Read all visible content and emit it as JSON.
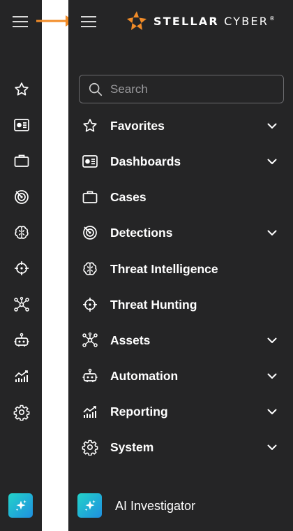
{
  "brand": {
    "name_bold": "STELLAR",
    "name_thin": " CYBER",
    "mark": "®",
    "accent": "#f28c28"
  },
  "search": {
    "placeholder": "Search",
    "value": ""
  },
  "nav": [
    {
      "key": "favorites",
      "label": "Favorites",
      "icon": "star-icon",
      "expandable": true
    },
    {
      "key": "dashboards",
      "label": "Dashboards",
      "icon": "dashboard-icon",
      "expandable": true
    },
    {
      "key": "cases",
      "label": "Cases",
      "icon": "briefcase-icon",
      "expandable": false
    },
    {
      "key": "detections",
      "label": "Detections",
      "icon": "radar-icon",
      "expandable": true
    },
    {
      "key": "threat-intelligence",
      "label": "Threat Intelligence",
      "icon": "brain-icon",
      "expandable": false
    },
    {
      "key": "threat-hunting",
      "label": "Threat Hunting",
      "icon": "crosshair-icon",
      "expandable": false
    },
    {
      "key": "assets",
      "label": "Assets",
      "icon": "network-icon",
      "expandable": true
    },
    {
      "key": "automation",
      "label": "Automation",
      "icon": "robot-icon",
      "expandable": true
    },
    {
      "key": "reporting",
      "label": "Reporting",
      "icon": "chart-icon",
      "expandable": true
    },
    {
      "key": "system",
      "label": "System",
      "icon": "gear-icon",
      "expandable": true
    }
  ],
  "ai": {
    "label": "AI Investigator",
    "icon": "sparkle-icon"
  },
  "colors": {
    "background": "#252526",
    "text": "#ffffff",
    "gap": "#ffffff",
    "ai_gradient_start": "#22d3c9",
    "ai_gradient_end": "#1f8fe0"
  }
}
